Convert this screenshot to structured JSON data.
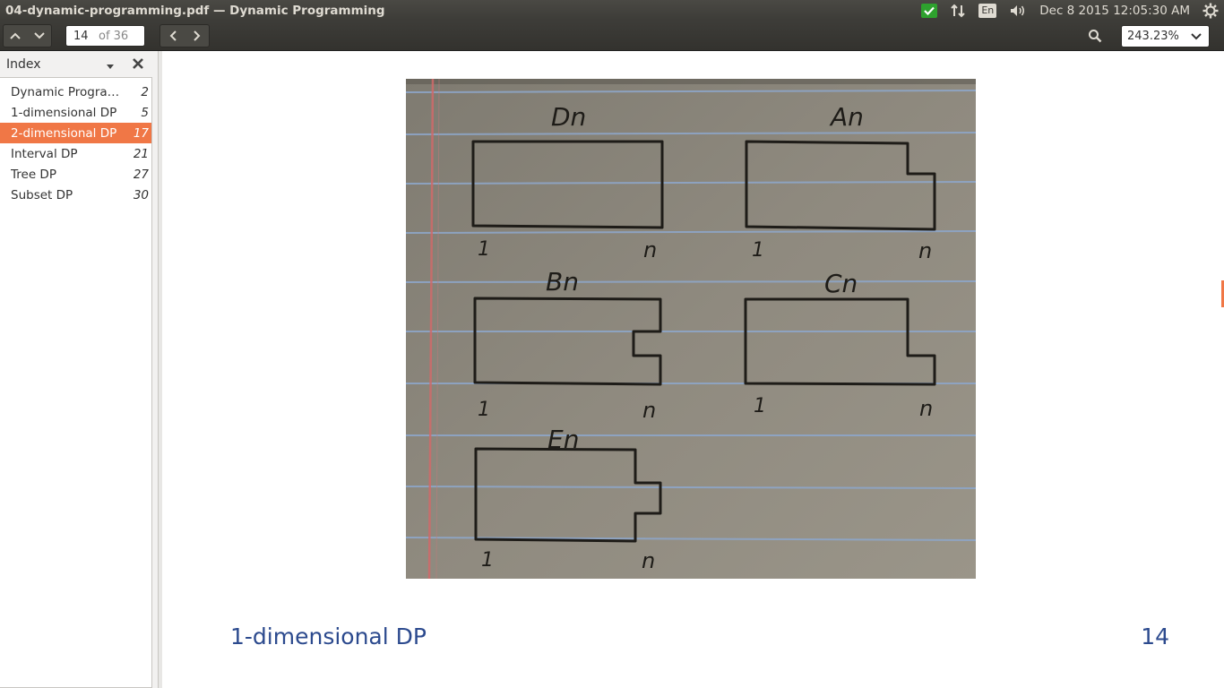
{
  "window": {
    "title": "04-dynamic-programming.pdf — Dynamic Programming"
  },
  "tray": {
    "keyboard_layout": "En",
    "clock": "Dec  8 2015 12:05:30 AM"
  },
  "toolbar": {
    "page_current": "14",
    "page_total_label": "of 36",
    "zoom": "243.23%"
  },
  "sidebar": {
    "title": "Index",
    "items": [
      {
        "label": "Dynamic Programming",
        "page": "2",
        "active": false
      },
      {
        "label": "1-dimensional DP",
        "page": "5",
        "active": false
      },
      {
        "label": "2-dimensional DP",
        "page": "17",
        "active": true
      },
      {
        "label": "Interval DP",
        "page": "21",
        "active": false
      },
      {
        "label": "Tree DP",
        "page": "27",
        "active": false
      },
      {
        "label": "Subset DP",
        "page": "30",
        "active": false
      }
    ]
  },
  "slide": {
    "title": "1-dimensional DP",
    "number": "14",
    "photo_labels": {
      "d": "Dn",
      "a": "An",
      "b": "Bn",
      "c": "Cn",
      "e": "En",
      "start": "1",
      "end": "n"
    }
  },
  "colors": {
    "accent": "#f07746",
    "slide_text": "#2c4a8e",
    "paper": "#8c887d",
    "ruled_line": "#8ea6c8"
  }
}
